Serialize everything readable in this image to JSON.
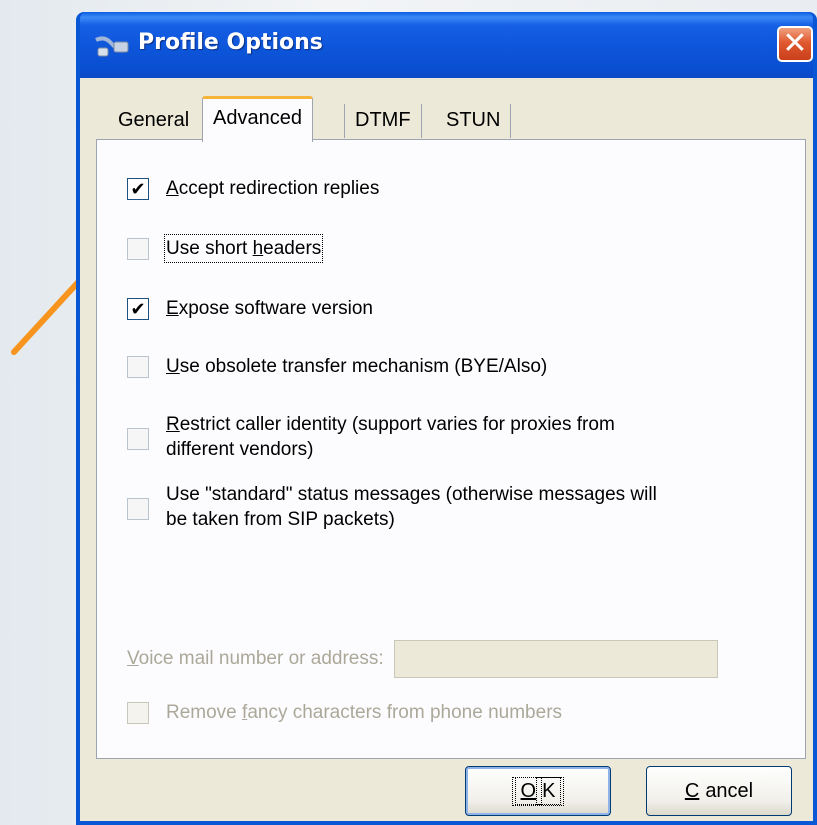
{
  "window": {
    "title": "Profile Options",
    "close_glyph": "✕",
    "title_icon": "network-plug-icon"
  },
  "tabs": [
    {
      "label": "General",
      "active": false
    },
    {
      "label": "Advanced",
      "active": true
    },
    {
      "label": "DTMF",
      "active": false
    },
    {
      "label": "STUN",
      "active": false
    }
  ],
  "options": [
    {
      "pre": "",
      "acc": "A",
      "post": "ccept redirection replies",
      "checked": true
    },
    {
      "pre": "Use short ",
      "acc": "h",
      "post": "eaders",
      "checked": false,
      "focused": true
    },
    {
      "pre": "",
      "acc": "E",
      "post": "xpose software version",
      "checked": true
    },
    {
      "pre": "",
      "acc": "U",
      "post": "se obsolete transfer mechanism (BYE/Also)",
      "checked": false
    },
    {
      "pre": "",
      "acc": "R",
      "post": "estrict caller identity (support varies for proxies from\ndifferent vendors)",
      "checked": false
    },
    {
      "pre": "Use \"standard\" status messages (otherwise messages will\nbe taken from SIP packets)",
      "acc": "",
      "post": "",
      "checked": false
    }
  ],
  "voice_mail": {
    "pre": "",
    "acc": "V",
    "post": "oice mail number or address:",
    "value": "",
    "enabled": false
  },
  "remove_fancy": {
    "pre": "Remove ",
    "acc": "f",
    "post": "ancy characters from phone numbers",
    "checked": false,
    "enabled": false
  },
  "buttons": {
    "ok": {
      "acc": "O",
      "post": "K"
    },
    "cancel": {
      "acc": "C",
      "post": "ancel"
    }
  },
  "colors": {
    "titlebar": "#0a57d6",
    "dialog_bg": "#ece9d8",
    "tab_highlight": "#f7b43a",
    "annotation_arrow": "#f7941d",
    "disabled_text": "#aca899"
  }
}
